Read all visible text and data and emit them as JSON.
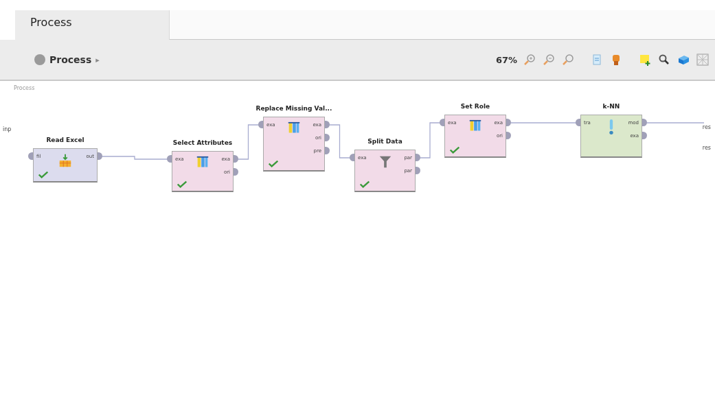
{
  "tabs": [
    {
      "label": "Process",
      "selected": true
    }
  ],
  "breadcrumb": {
    "label": "Process",
    "arrow": "▸"
  },
  "toolbar": {
    "zoom": "67%"
  },
  "canvas": {
    "label": "Process",
    "input_ports": [
      "inp"
    ],
    "output_ports": [
      "res",
      "res"
    ]
  },
  "operators": [
    {
      "title": "Read Excel",
      "kind": "data",
      "ok": true,
      "inputs": [
        "fil"
      ],
      "outputs": [
        "out"
      ]
    },
    {
      "title": "Select Attributes",
      "kind": "transform",
      "ok": true,
      "inputs": [
        "exa"
      ],
      "outputs": [
        "exa",
        "ori"
      ]
    },
    {
      "title": "Replace Missing Val...",
      "kind": "transform",
      "ok": true,
      "inputs": [
        "exa"
      ],
      "outputs": [
        "exa",
        "ori",
        "pre"
      ]
    },
    {
      "title": "Split Data",
      "kind": "transform",
      "ok": true,
      "inputs": [
        "exa"
      ],
      "outputs": [
        "par",
        "par"
      ]
    },
    {
      "title": "Set Role",
      "kind": "transform",
      "ok": true,
      "inputs": [
        "exa"
      ],
      "outputs": [
        "exa",
        "ori"
      ]
    },
    {
      "title": "k-NN",
      "kind": "model",
      "ok": false,
      "inputs": [
        "tra"
      ],
      "outputs": [
        "mod",
        "exa"
      ]
    }
  ]
}
